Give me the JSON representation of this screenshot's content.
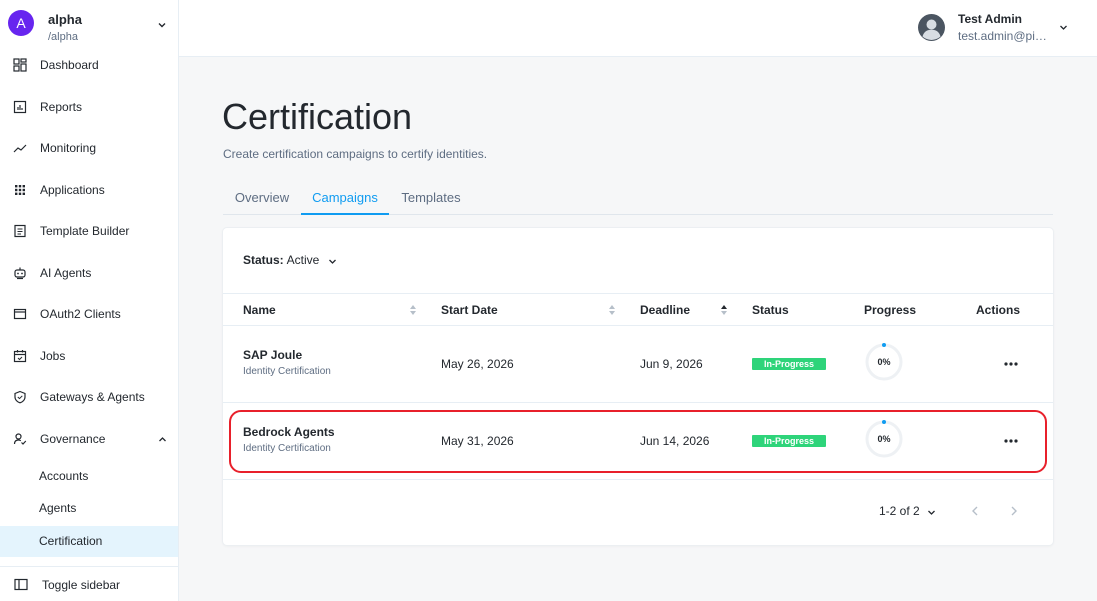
{
  "realm": {
    "initial": "A",
    "name": "alpha",
    "path": "/alpha"
  },
  "sidebar": {
    "items": [
      {
        "label": "Dashboard",
        "icon": "dashboard-icon"
      },
      {
        "label": "Reports",
        "icon": "reports-icon"
      },
      {
        "label": "Monitoring",
        "icon": "monitoring-icon"
      },
      {
        "label": "Applications",
        "icon": "applications-icon"
      },
      {
        "label": "Template Builder",
        "icon": "template-icon"
      },
      {
        "label": "AI Agents",
        "icon": "robot-icon"
      },
      {
        "label": "OAuth2 Clients",
        "icon": "window-icon"
      },
      {
        "label": "Jobs",
        "icon": "calendar-icon"
      },
      {
        "label": "Gateways & Agents",
        "icon": "shield-icon"
      },
      {
        "label": "Governance",
        "icon": "governance-icon"
      }
    ],
    "governance_sub": [
      {
        "label": "Accounts"
      },
      {
        "label": "Agents"
      },
      {
        "label": "Certification"
      }
    ],
    "toggle_label": "Toggle sidebar"
  },
  "user": {
    "name": "Test Admin",
    "email": "test.admin@pi…"
  },
  "page": {
    "title": "Certification",
    "subtitle": "Create certification campaigns to certify identities.",
    "tabs": [
      {
        "label": "Overview"
      },
      {
        "label": "Campaigns"
      },
      {
        "label": "Templates"
      }
    ]
  },
  "filter": {
    "label": "Status:",
    "value": "Active"
  },
  "table": {
    "columns": [
      "Name",
      "Start Date",
      "Deadline",
      "Status",
      "Progress",
      "Actions"
    ],
    "rows": [
      {
        "name": "SAP Joule",
        "type": "Identity Certification",
        "start": "May 26, 2026",
        "deadline": "Jun 9, 2026",
        "status": "In-Progress",
        "progress": "0%"
      },
      {
        "name": "Bedrock Agents",
        "type": "Identity Certification",
        "start": "May 31, 2026",
        "deadline": "Jun 14, 2026",
        "status": "In-Progress",
        "progress": "0%"
      }
    ]
  },
  "pagination": {
    "text": "1-2 of 2"
  },
  "colors": {
    "accent": "#109cf1",
    "status_green": "#2ed47a",
    "avatar": "#6725ef",
    "highlight": "#e8202b"
  }
}
